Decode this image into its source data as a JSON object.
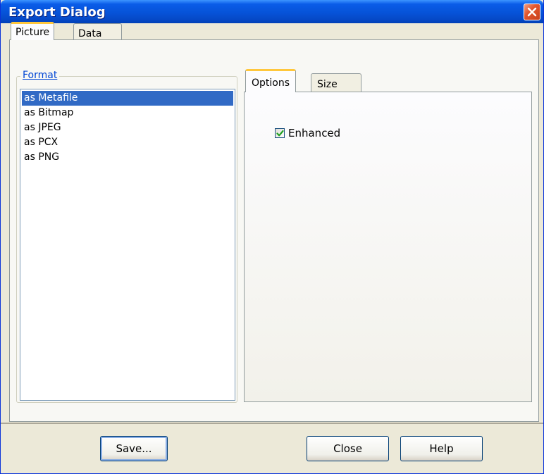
{
  "window": {
    "title": "Export Dialog"
  },
  "outer_tabs": [
    {
      "label": "Picture",
      "active": true
    },
    {
      "label": "Data",
      "active": false
    }
  ],
  "format_group": {
    "legend": "Format",
    "items": [
      "as Metafile",
      "as Bitmap",
      "as JPEG",
      "as PCX",
      "as PNG"
    ],
    "selected": "as Metafile"
  },
  "inner_tabs": [
    {
      "label": "Options",
      "active": true
    },
    {
      "label": "Size",
      "active": false
    }
  ],
  "options": {
    "enhanced_label": "Enhanced",
    "enhanced_checked": true
  },
  "buttons": {
    "save": "Save...",
    "close": "Close",
    "help": "Help"
  },
  "colors": {
    "title_bar": "#0653d8",
    "selection": "#316ac5",
    "tab_highlight": "#ffc73c",
    "close_button": "#e2562e"
  }
}
